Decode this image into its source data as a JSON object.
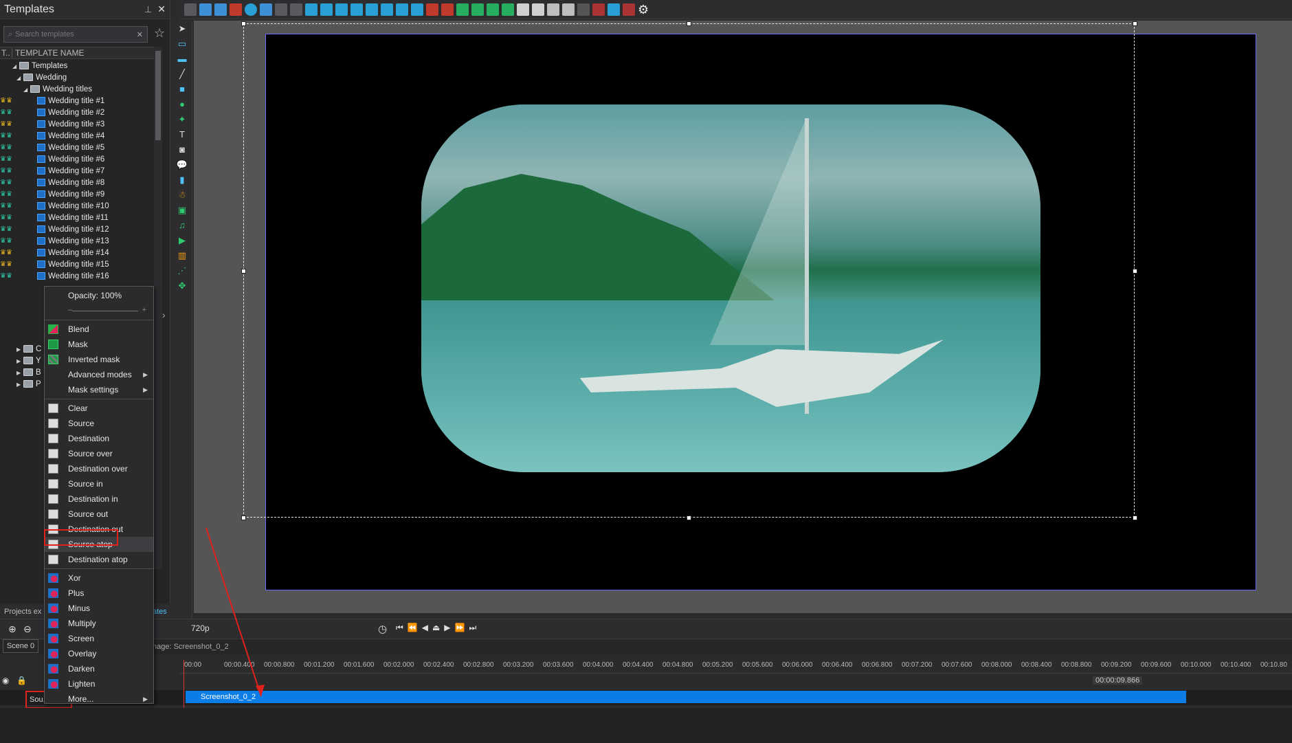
{
  "panel": {
    "title": "Templates",
    "search_placeholder": "Search templates",
    "col_t": "T..",
    "col_name": "TEMPLATE NAME"
  },
  "tree": {
    "root": "Templates",
    "wedding": "Wedding",
    "wedding_titles": "Wedding titles",
    "items": [
      "Wedding title #1",
      "Wedding title #2",
      "Wedding title #3",
      "Wedding title #4",
      "Wedding title #5",
      "Wedding title #6",
      "Wedding title #7",
      "Wedding title #8",
      "Wedding title #9",
      "Wedding title #10",
      "Wedding title #11",
      "Wedding title #12",
      "Wedding title #13",
      "Wedding title #14",
      "Wedding title #15",
      "Wedding title #16"
    ],
    "collapsed": [
      "C",
      "Y",
      "B",
      "P"
    ]
  },
  "menu": {
    "opacity": "Opacity: 100%",
    "group1": [
      "Blend",
      "Mask",
      "Inverted mask",
      "Advanced modes",
      "Mask settings"
    ],
    "group2": [
      "Clear",
      "Source",
      "Destination",
      "Source over",
      "Destination over",
      "Source in",
      "Destination in",
      "Source out",
      "Destination out",
      "Source atop",
      "Destination atop"
    ],
    "group3": [
      "Xor",
      "Plus",
      "Minus",
      "Multiply",
      "Screen",
      "Overlay",
      "Darken",
      "Lighten",
      "More..."
    ],
    "selected": "Source atop"
  },
  "bottom_tabs": {
    "projects": "Projects ex",
    "templates": "ates"
  },
  "timeline": {
    "quality": "720p",
    "scene": "Scene 0",
    "tab_label": "nage: Screenshot_0_2",
    "ticks": [
      "00:00",
      "00:00.400",
      "00:00.800",
      "00:01.200",
      "00:01.600",
      "00:02.000",
      "00:02.400",
      "00:02.800",
      "00:03.200",
      "00:03.600",
      "00:04.000",
      "00:04.400",
      "00:04.800",
      "00:05.200",
      "00:05.600",
      "00:06.000",
      "00:06.400",
      "00:06.800",
      "00:07.200",
      "00:07.600",
      "00:08.000",
      "00:08.400",
      "00:08.800",
      "00:09.200",
      "00:09.600",
      "00:10.000",
      "00:10.400",
      "00:10.80"
    ],
    "clip_label": "Screenshot_0_2",
    "clip_end": "00:00:09.866",
    "track_name": "Sou..."
  },
  "colors": {
    "accent": "#0b7de6",
    "highlight": "#e0221b"
  }
}
